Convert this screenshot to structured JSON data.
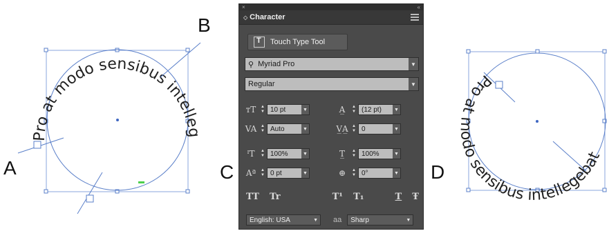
{
  "labels": {
    "a": "A",
    "b": "B",
    "c": "C",
    "d": "D"
  },
  "left_figure": {
    "path_text": "Pro at modo sensibus intellegebat"
  },
  "right_figure": {
    "path_text": "Pro at modo sensibus intellegebat"
  },
  "panel": {
    "title": "Character",
    "touch_type_button": "Touch Type Tool",
    "font_family": "Myriad Pro",
    "font_style": "Regular",
    "font_size": "10 pt",
    "leading": "(12 pt)",
    "kerning": "Auto",
    "tracking": "0",
    "vertical_scale": "100%",
    "horizontal_scale": "100%",
    "baseline_shift": "0 pt",
    "character_rotation": "0°",
    "glyph_buttons": [
      "TT",
      "Tr",
      "T¹",
      "T₁",
      "T",
      "Ŧ"
    ],
    "language": "English: USA",
    "anti_aliasing_icon": "aa",
    "anti_aliasing": "Sharp"
  },
  "colors": {
    "guide_blue": "#5a7fc9",
    "panel_bg": "#4a4a4a",
    "field_bg": "#bdbdbd",
    "anchor_green": "#4dd04d"
  }
}
